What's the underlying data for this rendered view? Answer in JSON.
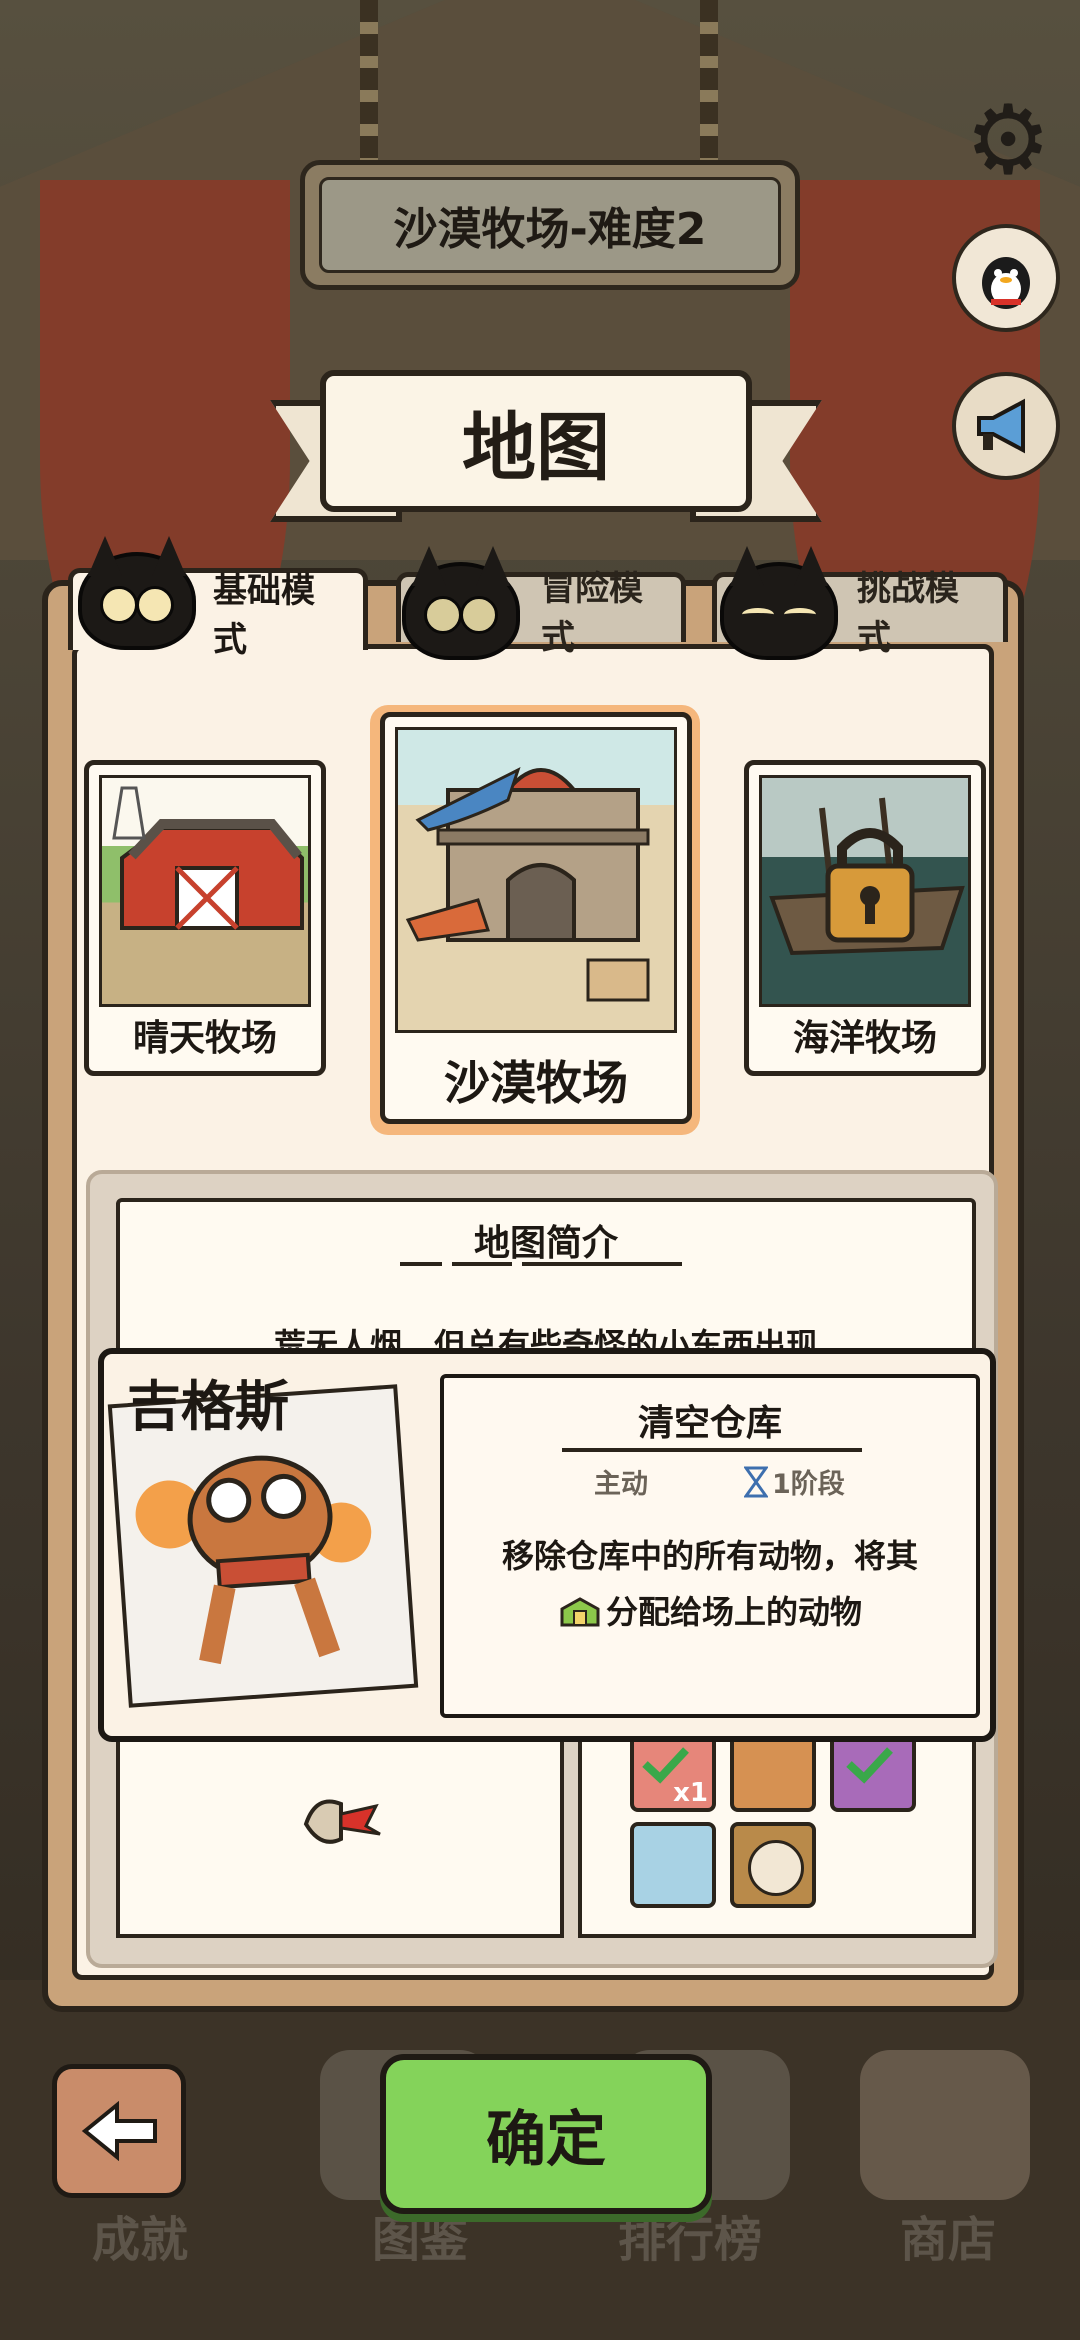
{
  "header": {
    "title": "沙漠牧场-难度2"
  },
  "map_banner": {
    "title": "地图"
  },
  "tabs": [
    {
      "label": "基础模式",
      "active": true
    },
    {
      "label": "冒险模式",
      "active": false
    },
    {
      "label": "挑战模式",
      "active": false
    }
  ],
  "maps": [
    {
      "name": "晴天牧场",
      "selected": false,
      "locked": false
    },
    {
      "name": "沙漠牧场",
      "selected": true,
      "locked": false
    },
    {
      "name": "海洋牧场",
      "selected": false,
      "locked": true
    }
  ],
  "intro": {
    "title": "地图简介",
    "text": "荒无人烟，但总有些奇怪的小东西出现"
  },
  "character": {
    "name": "吉格斯",
    "skill": {
      "name": "清空仓库",
      "type": "主动",
      "stage": "1阶段",
      "desc_line1": "移除仓库中的所有动物，将其",
      "desc_line2": "分配给场上的动物"
    }
  },
  "items": {
    "count_badge": "x1"
  },
  "buttons": {
    "confirm": "确定"
  },
  "bottom_nav": [
    "成就",
    "图鉴",
    "排行榜",
    "商店"
  ],
  "colors": {
    "accent_green": "#84d35a",
    "panel_brown": "#c9a37a",
    "paper": "#fbf2e5"
  },
  "icons": [
    "settings-gear-icon",
    "qq-penguin-icon",
    "megaphone-icon",
    "back-arrow-icon",
    "lock-icon",
    "hourglass-icon"
  ]
}
